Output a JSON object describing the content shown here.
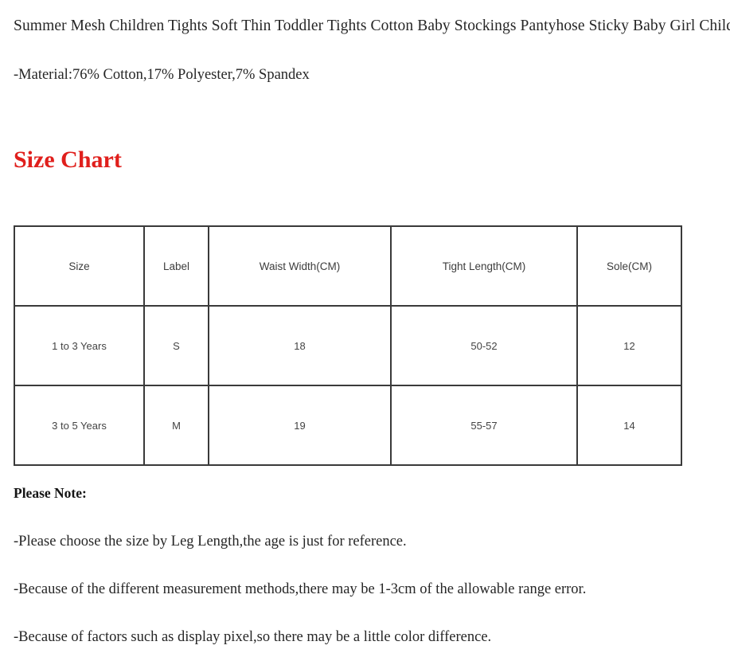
{
  "page": {
    "background_color": "#ffffff",
    "text_color": "#262626",
    "accent_color": "#e01f1c",
    "table_border_color": "#3a3a3a"
  },
  "product": {
    "title": "Summer Mesh Children Tights Soft Thin Toddler Tights Cotton Baby Stockings Pantyhose Sticky Baby Girl Children's Pant",
    "material": "-Material:76% Cotton,17% Polyester,7% Spandex"
  },
  "size_chart": {
    "heading": "Size Chart",
    "columns": [
      "Size",
      "Label",
      "Waist Width(CM)",
      "Tight Length(CM)",
      "Sole(CM)"
    ],
    "rows": [
      {
        "size": "1 to 3 Years",
        "label": "S",
        "waist_width": "18",
        "tight_length": "50-52",
        "sole": "12"
      },
      {
        "size": "3 to 5 Years",
        "label": "M",
        "waist_width": "19",
        "tight_length": "55-57",
        "sole": "14"
      }
    ]
  },
  "notes": {
    "heading": "Please Note:",
    "lines": [
      "-Please choose the size by Leg Length,the age is just for reference.",
      "-Because of the different measurement methods,there may be 1-3cm of the allowable range error.",
      "-Because of factors such as display pixel,so there may be a little color difference."
    ]
  }
}
